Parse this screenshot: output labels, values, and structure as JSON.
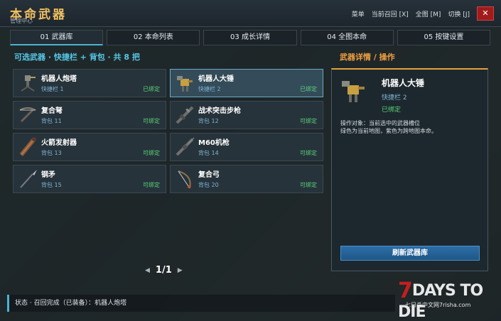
{
  "header": {
    "title": "本命武器",
    "subtitle": "管理中心",
    "menu": [
      "菜单",
      "当前召回 [X]",
      "全图 [M]",
      "切换 [J]"
    ],
    "close_label": "✕"
  },
  "tabs": [
    {
      "label": "01 武器库",
      "active": true
    },
    {
      "label": "02 本命列表",
      "active": false
    },
    {
      "label": "03 成长详情",
      "active": false
    },
    {
      "label": "04 全图本命",
      "active": false
    },
    {
      "label": "05 按键设置",
      "active": false
    }
  ],
  "list": {
    "title": "可选武器 · 快捷栏 + 背包 · 共 8 把",
    "items": [
      {
        "name": "机器人炮塔",
        "location": "快捷栏 1",
        "state": "已绑定",
        "icon": "turret-icon"
      },
      {
        "name": "机器人大锤",
        "location": "快捷栏 2",
        "state": "已绑定",
        "icon": "sledge-robot-icon"
      },
      {
        "name": "复合弩",
        "location": "背包 11",
        "state": "可绑定",
        "icon": "crossbow-icon"
      },
      {
        "name": "战术突击步枪",
        "location": "背包 12",
        "state": "可绑定",
        "icon": "assault-rifle-icon"
      },
      {
        "name": "火箭发射器",
        "location": "背包 13",
        "state": "可绑定",
        "icon": "rocket-launcher-icon"
      },
      {
        "name": "M60机枪",
        "location": "背包 14",
        "state": "可绑定",
        "icon": "machine-gun-icon"
      },
      {
        "name": "钢矛",
        "location": "背包 15",
        "state": "可绑定",
        "icon": "spear-icon"
      },
      {
        "name": "复合弓",
        "location": "背包 20",
        "state": "可绑定",
        "icon": "compound-bow-icon"
      }
    ],
    "page": "1/1",
    "prev_label": "◀",
    "next_label": "▶"
  },
  "detail": {
    "title": "武器详情 / 操作",
    "name": "机器人大锤",
    "location": "快捷栏 2",
    "state": "已绑定",
    "desc_line1": "操作对象：当前选中的武器槽位",
    "desc_line2": "绿色为当前地图，紫色为跨地图本命。",
    "refresh_label": "刷新武器库"
  },
  "status": {
    "text": "状态 · 召回完成（已装备）：机器人炮塔"
  },
  "logo": {
    "seven": "7",
    "main": "DAYS TO DIE",
    "sub": "七日杀中文网7risha.com"
  },
  "colors": {
    "accent_blue": "#4ab4d0",
    "accent_orange": "#e6a23a",
    "bound_green": "#5ad07a",
    "title_gold": "#f0c060"
  }
}
